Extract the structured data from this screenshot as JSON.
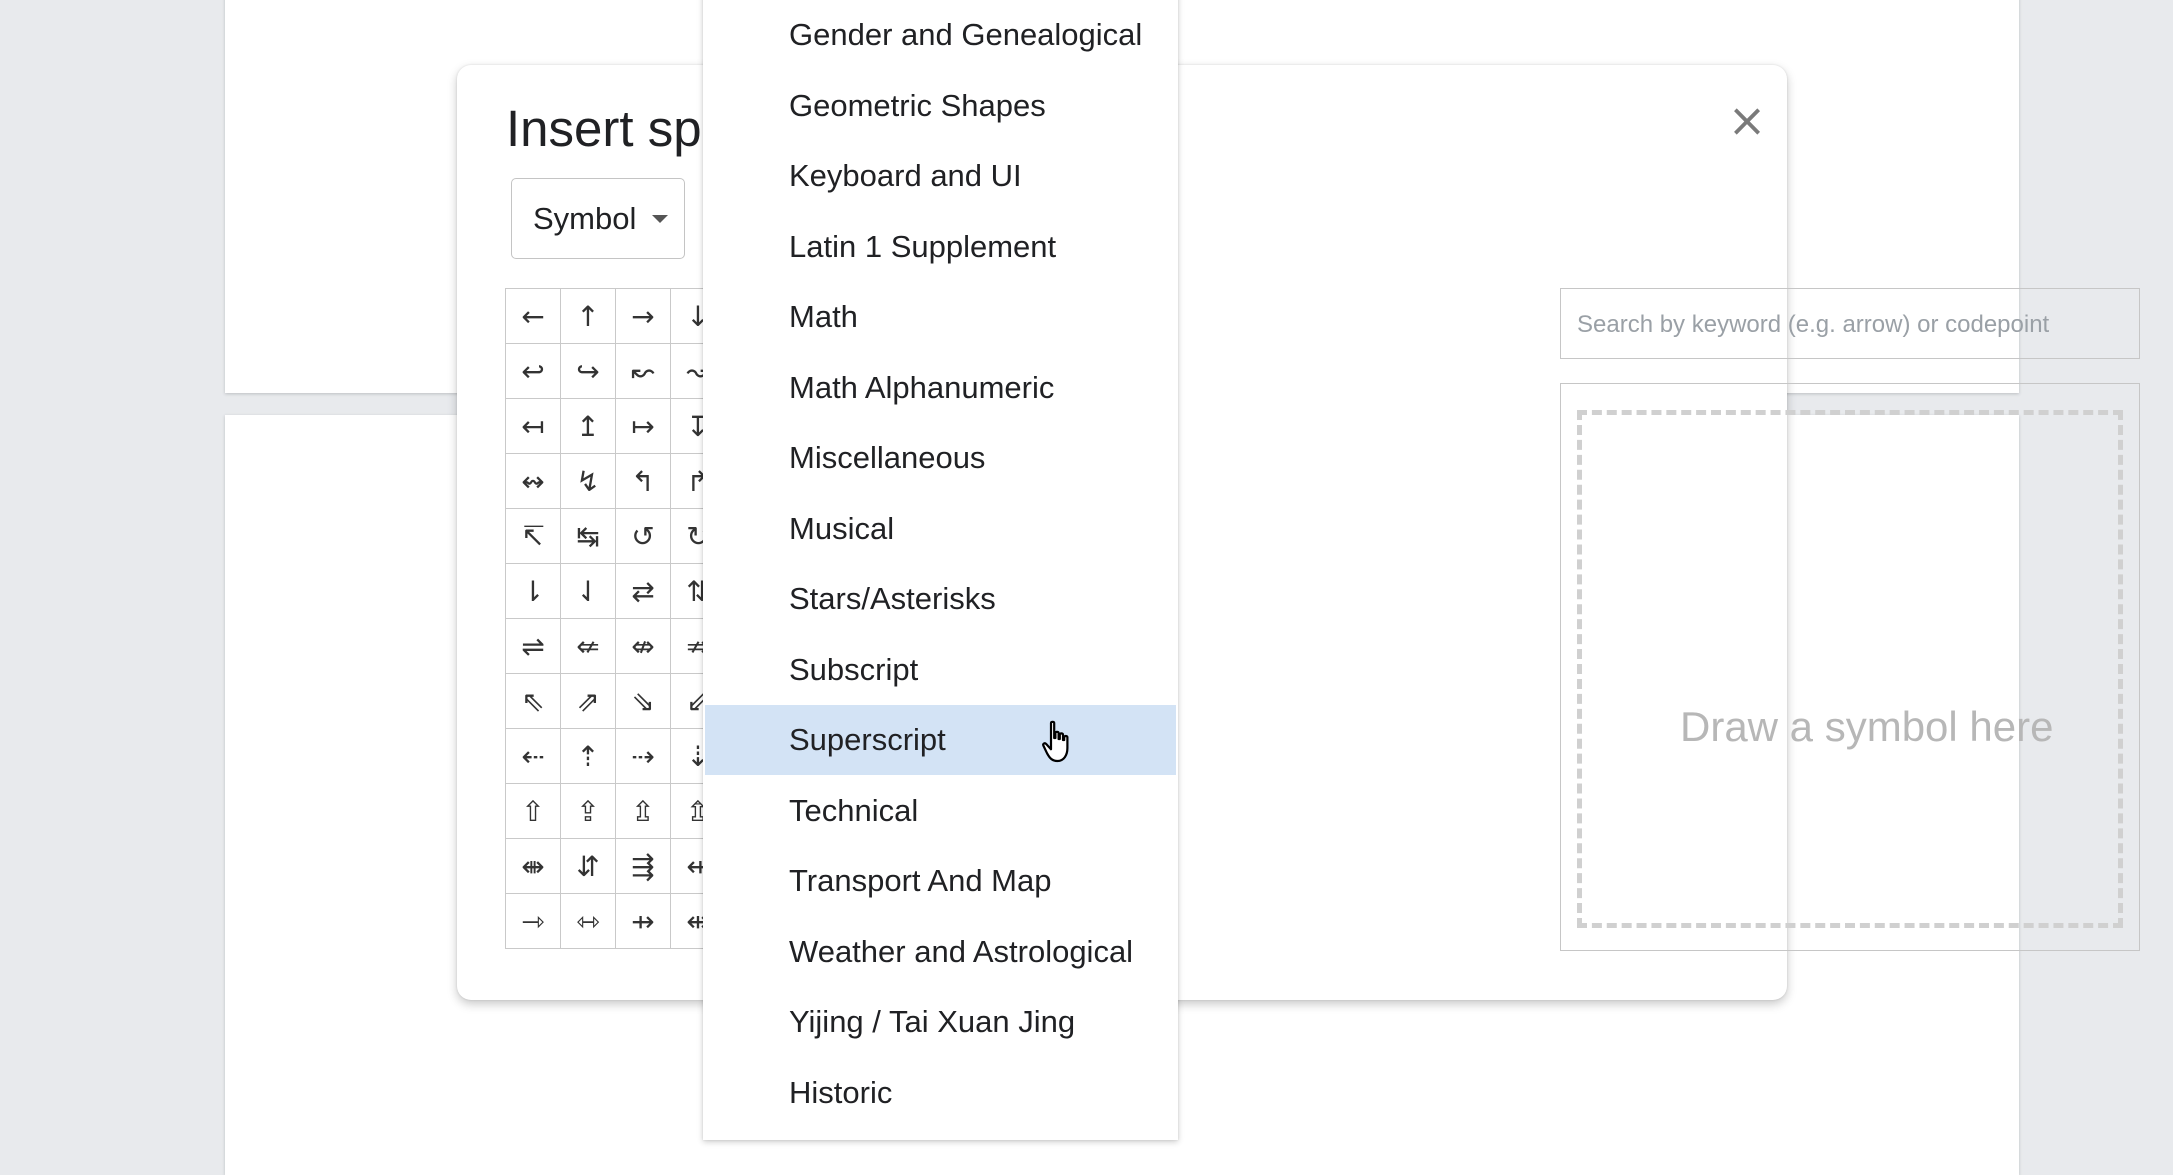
{
  "dialog": {
    "title": "Insert spe",
    "close_glyph": "×",
    "category_value": "Symbol",
    "search_placeholder": "Search by keyword (e.g. arrow) or codepoint",
    "draw_hint": "Draw a symbol here"
  },
  "symbols": [
    "←",
    "↑",
    "→",
    "↓",
    "↩",
    "↪",
    "↜",
    "↝",
    "↤",
    "↥",
    "↦",
    "↧",
    "↭",
    "↯",
    "↰",
    "↱",
    "↸",
    "↹",
    "↺",
    "↻",
    "⇂",
    "⇃",
    "⇄",
    "⇅",
    "⇌",
    "⇍",
    "⇎",
    "⇏",
    "⇖",
    "⇗",
    "⇘",
    "⇙",
    "⇠",
    "⇡",
    "⇢",
    "⇣",
    "⇧",
    "⇪",
    "⇫",
    "⇬",
    "⇼",
    "⇵",
    "⇶",
    "⇷",
    "⇾",
    "⇿",
    "⇸",
    "⇹"
  ],
  "dropdown": {
    "items": [
      {
        "label": "Gender and Genealogical",
        "highlighted": false
      },
      {
        "label": "Geometric Shapes",
        "highlighted": false
      },
      {
        "label": "Keyboard and UI",
        "highlighted": false
      },
      {
        "label": "Latin 1 Supplement",
        "highlighted": false
      },
      {
        "label": "Math",
        "highlighted": false
      },
      {
        "label": "Math Alphanumeric",
        "highlighted": false
      },
      {
        "label": "Miscellaneous",
        "highlighted": false
      },
      {
        "label": "Musical",
        "highlighted": false
      },
      {
        "label": "Stars/Asterisks",
        "highlighted": false
      },
      {
        "label": "Subscript",
        "highlighted": false
      },
      {
        "label": "Superscript",
        "highlighted": true
      },
      {
        "label": "Technical",
        "highlighted": false
      },
      {
        "label": "Transport And Map",
        "highlighted": false
      },
      {
        "label": "Weather and Astrological",
        "highlighted": false
      },
      {
        "label": "Yijing / Tai Xuan Jing",
        "highlighted": false
      },
      {
        "label": "Historic",
        "highlighted": false
      }
    ],
    "highlight_color": "#d3e3f5"
  },
  "cursor_icon": "hand-pointer-icon"
}
